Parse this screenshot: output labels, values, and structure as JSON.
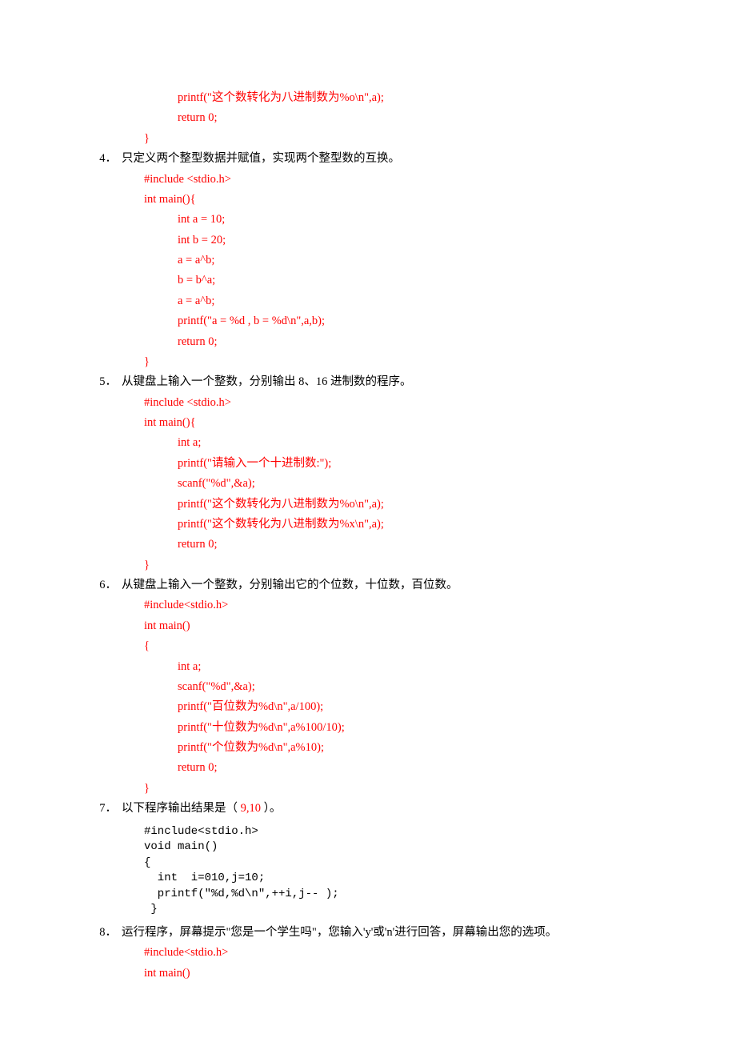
{
  "codeTop": [
    "printf(\"这个数转化为八进制数为%o\\n\",a);",
    "return 0;"
  ],
  "codeTopClose": "}",
  "q4": {
    "num": "4．",
    "text": "只定义两个整型数据并赋值，实现两个整型数的互换。",
    "code": [
      "#include <stdio.h>",
      "int main(){"
    ],
    "body": [
      "int a = 10;",
      "int b = 20;",
      "a = a^b;",
      "b = b^a;",
      "a = a^b;",
      "printf(\"a = %d , b = %d\\n\",a,b);",
      "return 0;"
    ],
    "close": "}"
  },
  "q5": {
    "num": "5．",
    "text": "从键盘上输入一个整数，分别输出 8、16 进制数的程序。",
    "code": [
      "#include <stdio.h>",
      "int main(){"
    ],
    "body": [
      "int a;",
      "printf(\"请输入一个十进制数:\");",
      "scanf(\"%d\",&a);",
      "printf(\"这个数转化为八进制数为%o\\n\",a);",
      "printf(\"这个数转化为八进制数为%x\\n\",a);",
      "return 0;"
    ],
    "close": "}"
  },
  "q6": {
    "num": "6．",
    "text": "从键盘上输入一个整数，分别输出它的个位数，十位数，百位数。",
    "code": [
      "#include<stdio.h>",
      "int main()",
      "{"
    ],
    "body": [
      "int a;",
      "scanf(\"%d\",&a);",
      "printf(\"百位数为%d\\n\",a/100);",
      "printf(\"十位数为%d\\n\",a%100/10);",
      "printf(\"个位数为%d\\n\",a%10);",
      "return 0;"
    ],
    "close": "}"
  },
  "q7": {
    "num": "7．",
    "textPrefix": "以下程序输出结果是（ ",
    "answer": "9,10",
    "textSuffix": " ）。",
    "code": [
      "#include<stdio.h>",
      "void main()",
      "{",
      "  int  i=010,j=10;",
      "  printf(\"%d,%d\\n\",++i,j-- );",
      " }"
    ]
  },
  "q8": {
    "num": "8．",
    "text": "运行程序，屏幕提示\"您是一个学生吗\"，您输入'y'或'n'进行回答，屏幕输出您的选项。",
    "code": [
      "#include<stdio.h>",
      "int main()"
    ]
  }
}
